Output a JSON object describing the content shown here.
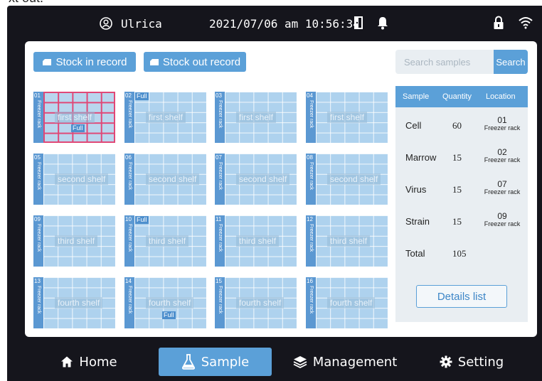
{
  "page": {
    "fragment_text": "xt out."
  },
  "status_bar": {
    "user_name": "Ulrica",
    "datetime": "2021/07/06 am 10:56:34"
  },
  "records": {
    "stock_in_label": "Stock in record",
    "stock_out_label": "Stock out record"
  },
  "search": {
    "placeholder": "Search samples",
    "button_label": "Search"
  },
  "racks": [
    {
      "number": "01",
      "label": "Freezer rack",
      "shelf": "first shelf",
      "full": true,
      "highlight": true
    },
    {
      "number": "02",
      "label": "Freezer rack",
      "shelf": "first shelf",
      "full": true,
      "highlight": false
    },
    {
      "number": "03",
      "label": "Freezer rack",
      "shelf": "first shelf",
      "full": false,
      "highlight": false
    },
    {
      "number": "04",
      "label": "Freezer rack",
      "shelf": "first shelf",
      "full": false,
      "highlight": false
    },
    {
      "number": "05",
      "label": "Freezer rack",
      "shelf": "second shelf",
      "full": false,
      "highlight": false
    },
    {
      "number": "06",
      "label": "Freezer rack",
      "shelf": "second shelf",
      "full": false,
      "highlight": false
    },
    {
      "number": "07",
      "label": "Freezer rack",
      "shelf": "second shelf",
      "full": false,
      "highlight": false
    },
    {
      "number": "08",
      "label": "Freezer rack",
      "shelf": "second shelf",
      "full": false,
      "highlight": false
    },
    {
      "number": "09",
      "label": "Freezer rack",
      "shelf": "third shelf",
      "full": false,
      "highlight": false
    },
    {
      "number": "10",
      "label": "Freezer rack",
      "shelf": "third shelf",
      "full": true,
      "highlight": false
    },
    {
      "number": "11",
      "label": "Freezer rack",
      "shelf": "third shelf",
      "full": false,
      "highlight": false
    },
    {
      "number": "12",
      "label": "Freezer rack",
      "shelf": "third shelf",
      "full": false,
      "highlight": false
    },
    {
      "number": "13",
      "label": "Freezer rack",
      "shelf": "fourth shelf",
      "full": false,
      "highlight": false
    },
    {
      "number": "14",
      "label": "Freezer rack",
      "shelf": "fourth shelf",
      "full": true,
      "highlight": false
    },
    {
      "number": "15",
      "label": "Freezer rack",
      "shelf": "fourth shelf",
      "full": false,
      "highlight": false
    },
    {
      "number": "16",
      "label": "Freezer rack",
      "shelf": "fourth shelf",
      "full": false,
      "highlight": false
    }
  ],
  "full_badge_label": "Full",
  "summary_table": {
    "headers": [
      "Sample",
      "Quantity",
      "Location"
    ],
    "rows": [
      {
        "sample": "Cell",
        "quantity": "60",
        "location": "01",
        "location_sub": "Freezer rack"
      },
      {
        "sample": "Marrow",
        "quantity": "15",
        "location": "02",
        "location_sub": "Freezer rack"
      },
      {
        "sample": "Virus",
        "quantity": "15",
        "location": "07",
        "location_sub": "Freezer rack"
      },
      {
        "sample": "Strain",
        "quantity": "15",
        "location": "09",
        "location_sub": "Freezer rack"
      }
    ],
    "total_label": "Total",
    "total_value": "105",
    "details_button": "Details list"
  },
  "nav": {
    "items": [
      {
        "label": "Home",
        "icon": "home-icon",
        "active": false
      },
      {
        "label": "Sample",
        "icon": "flask-icon",
        "active": true
      },
      {
        "label": "Management",
        "icon": "layers-icon",
        "active": false
      },
      {
        "label": "Setting",
        "icon": "gear-icon",
        "active": false
      }
    ]
  },
  "colors": {
    "accent": "#5ba0d8",
    "rack_fill": "#aed2ee",
    "rack_strip": "#5b98d2",
    "highlight": "#e04877",
    "device_background": "#15151c"
  }
}
